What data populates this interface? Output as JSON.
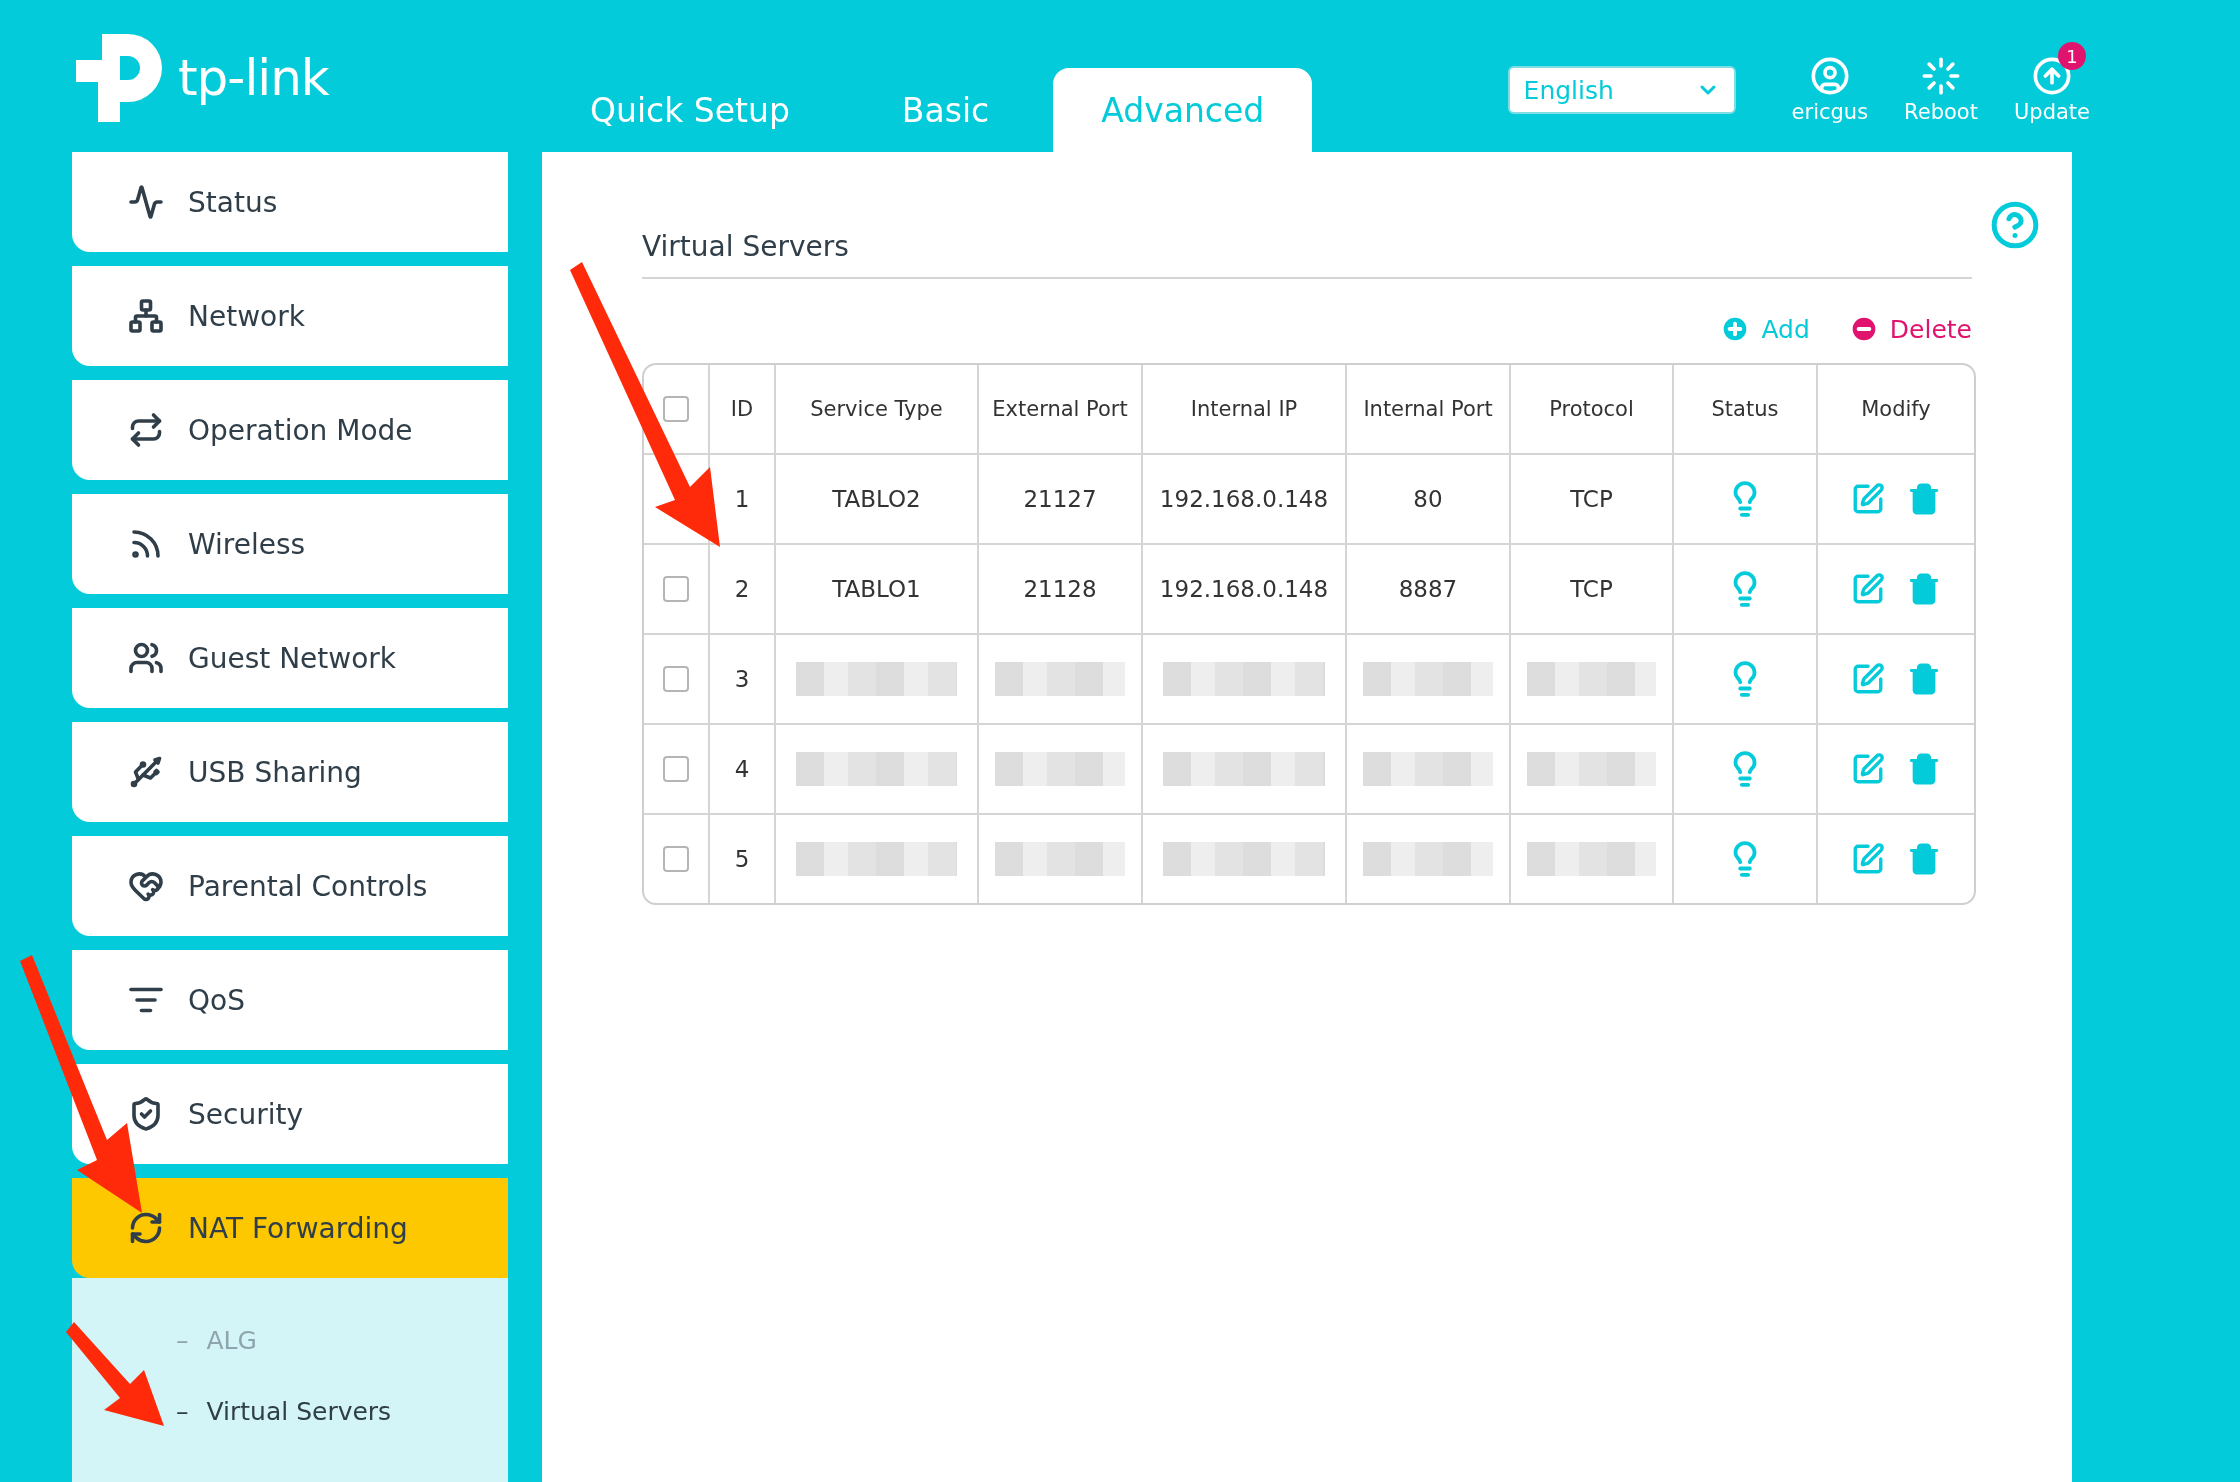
{
  "logo": {
    "text": "tp-link"
  },
  "tabs": [
    {
      "label": "Quick Setup",
      "selected": false
    },
    {
      "label": "Basic",
      "selected": false
    },
    {
      "label": "Advanced",
      "selected": true
    }
  ],
  "language": {
    "value": "English"
  },
  "header_actions": [
    {
      "kind": "user",
      "label": "ericgus"
    },
    {
      "kind": "reboot",
      "label": "Reboot"
    },
    {
      "kind": "update",
      "label": "Update",
      "badge": "1"
    }
  ],
  "sidebar": {
    "items": [
      {
        "kind": "status",
        "label": "Status",
        "selected": false
      },
      {
        "kind": "network",
        "label": "Network",
        "selected": false
      },
      {
        "kind": "mode",
        "label": "Operation Mode",
        "selected": false
      },
      {
        "kind": "wireless",
        "label": "Wireless",
        "selected": false
      },
      {
        "kind": "guest",
        "label": "Guest Network",
        "selected": false
      },
      {
        "kind": "usb",
        "label": "USB Sharing",
        "selected": false
      },
      {
        "kind": "parental",
        "label": "Parental Controls",
        "selected": false
      },
      {
        "kind": "qos",
        "label": "QoS",
        "selected": false
      },
      {
        "kind": "security",
        "label": "Security",
        "selected": false
      },
      {
        "kind": "nat",
        "label": "NAT Forwarding",
        "selected": true,
        "expanded": true,
        "children": [
          {
            "marker": "–",
            "label": "ALG",
            "selected": false
          },
          {
            "marker": "–",
            "label": "Virtual Servers",
            "selected": true
          }
        ]
      }
    ]
  },
  "section": {
    "title": "Virtual Servers",
    "add": "Add",
    "delete": "Delete"
  },
  "table": {
    "header_checked": false,
    "columns": [
      "ID",
      "Service Type",
      "External Port",
      "Internal IP",
      "Internal Port",
      "Protocol",
      "Status",
      "Modify"
    ],
    "rows": [
      {
        "redacted": false,
        "cells": [
          "1",
          "TABLO2",
          "21127",
          "192.168.0.148",
          "80",
          "TCP"
        ]
      },
      {
        "checked": false,
        "redacted": false,
        "cells": [
          "2",
          "TABLO1",
          "21128",
          "192.168.0.148",
          "8887",
          "TCP"
        ]
      },
      {
        "checked": false,
        "redacted": true,
        "cells": [
          "3"
        ]
      },
      {
        "checked": false,
        "redacted": true,
        "cells": [
          "4"
        ]
      },
      {
        "checked": false,
        "redacted": true,
        "cells": [
          "5"
        ]
      }
    ]
  },
  "annotations": [
    {
      "kind": "arrow"
    },
    {
      "kind": "arrow"
    },
    {
      "kind": "arrow"
    }
  ]
}
